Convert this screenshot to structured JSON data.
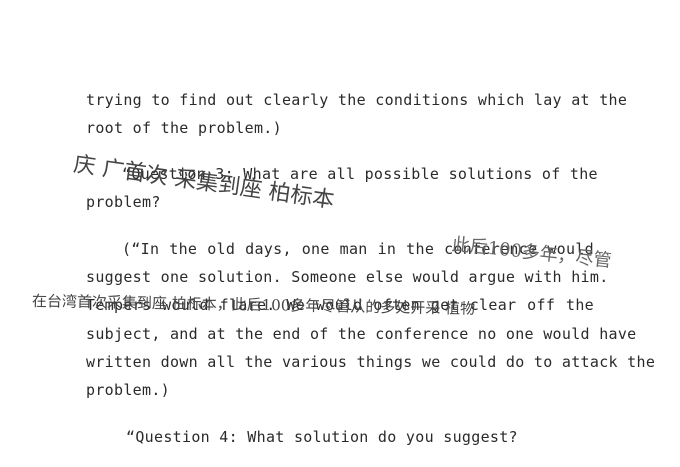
{
  "document": {
    "lines": [
      "trying to find out clearly the conditions which lay at the",
      "root of the problem.)",
      "“Question 3: What are all possible solutions of the",
      "problem?",
      "(“In the old days, one man in the conference would",
      "suggest one solution. Someone else would argue with him.",
      "Tempers would flare. We would often get clear off the",
      "subject, and at the end of the conference no one would have",
      "written down all the various things we could do to attack the",
      "problem.)",
      "“Question 4: What solution do you suggest?"
    ]
  },
  "annotations": {
    "note_1": "庆 广首次 采集到座 柏标本",
    "note_2": "此后100多年，尽管",
    "note_3": "在台湾首次采集到座 柏标本，此后100多年尽管从的多处开采 植物"
  }
}
